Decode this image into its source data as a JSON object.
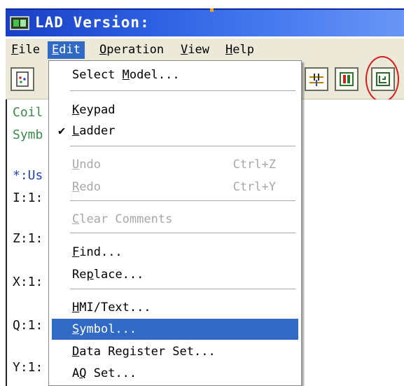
{
  "window": {
    "title": "LAD Version:"
  },
  "menubar": {
    "items": [
      {
        "label": "File",
        "key": "F",
        "rest": "ile"
      },
      {
        "label": "Edit",
        "key": "E",
        "rest": "dit"
      },
      {
        "label": "Operation",
        "key": "O",
        "rest": "peration"
      },
      {
        "label": "View",
        "key": "V",
        "rest": "iew"
      },
      {
        "label": "Help",
        "key": "H",
        "rest": "elp"
      }
    ]
  },
  "editor": {
    "lines": [
      "Coil",
      "Symb",
      "*:Us",
      "I:1:",
      "Z:1:",
      "X:1:",
      "Q:1:",
      "Y:1:"
    ]
  },
  "edit_menu": {
    "select_model": {
      "pre": "Select ",
      "key": "M",
      "post": "odel..."
    },
    "keypad": {
      "key": "K",
      "post": "eypad"
    },
    "ladder": {
      "key": "L",
      "post": "adder",
      "check": "✔"
    },
    "undo": {
      "key": "U",
      "post": "ndo",
      "shortcut": "Ctrl+Z"
    },
    "redo": {
      "key": "R",
      "post": "edo",
      "shortcut": "Ctrl+Y"
    },
    "clear_comments": {
      "key": "C",
      "post": "lear Comments"
    },
    "find": {
      "key": "F",
      "post": "ind..."
    },
    "replace": {
      "pre": "Re",
      "key": "p",
      "post": "lace..."
    },
    "hmi_text": {
      "key": "H",
      "post": "MI/Text..."
    },
    "symbol": {
      "key": "S",
      "post": "ymbol..."
    },
    "data_register_set": {
      "key": "D",
      "post": "ata Register Set..."
    },
    "aq_set": {
      "pre": "A",
      "key": "Q",
      "post": " Set..."
    }
  },
  "colors": {
    "title_bar": "#2c5fe0",
    "highlight": "#316ac5",
    "annotation_circle": "#d81e1e",
    "comment_green": "#3a8a4a",
    "comment_blue": "#2040c0"
  },
  "icons": {
    "app": "app-icon",
    "toolbar": [
      "select-model-icon",
      "contact-icon",
      "ladder-block-icon",
      "symbol-icon"
    ]
  }
}
